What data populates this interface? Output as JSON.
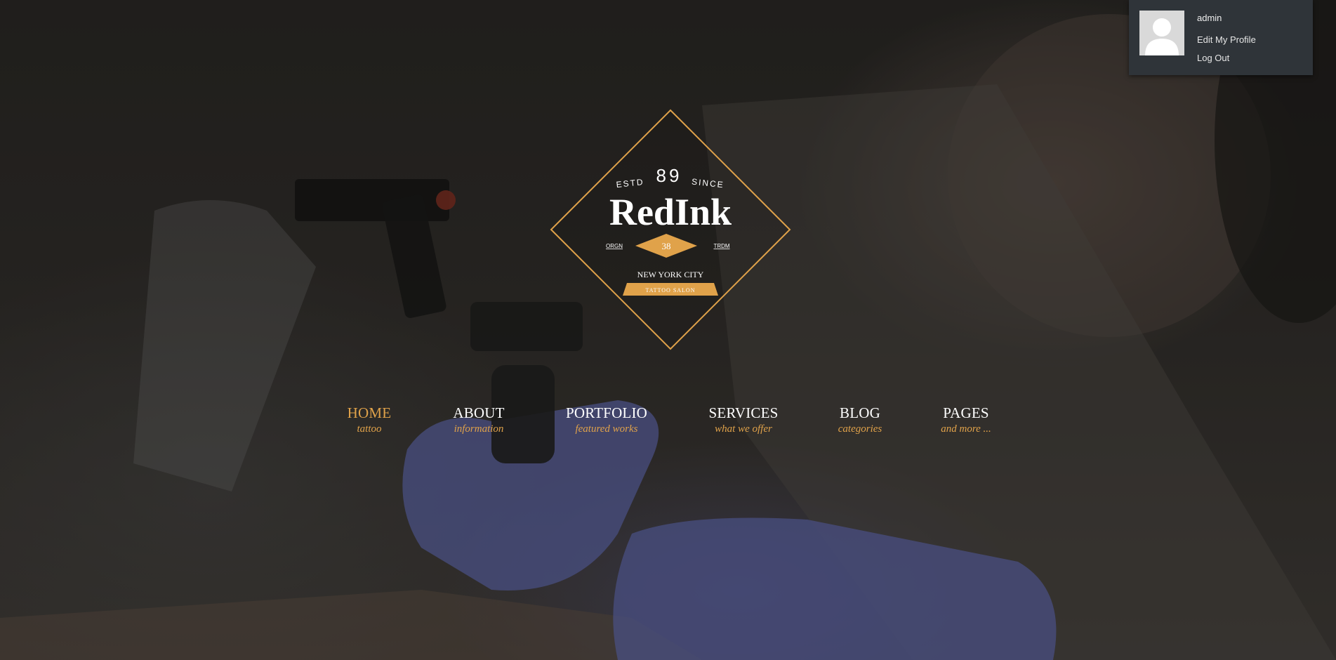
{
  "colors": {
    "accent": "#e0a24a",
    "nav_text": "#ffffff",
    "admin_bg": "#2f3439"
  },
  "admin_bar": {
    "username": "admin",
    "edit_profile": "Edit My Profile",
    "log_out": "Log Out",
    "avatar_icon": "user-silhouette-icon"
  },
  "logo": {
    "estd": "ESTD",
    "year_top": "89",
    "since": "SINCE",
    "brand": "RedInk",
    "left_tag": "ORGN",
    "right_tag": "TRDM",
    "badge_number": "38",
    "city": "NEW YORK CITY",
    "ribbon": "TATTOO SALON"
  },
  "nav": {
    "items": [
      {
        "label": "HOME",
        "sub": "tattoo",
        "active": true
      },
      {
        "label": "ABOUT",
        "sub": "information",
        "active": false
      },
      {
        "label": "PORTFOLIO",
        "sub": "featured works",
        "active": false
      },
      {
        "label": "SERVICES",
        "sub": "what we offer",
        "active": false
      },
      {
        "label": "BLOG",
        "sub": "categories",
        "active": false
      },
      {
        "label": "PAGES",
        "sub": "and more ...",
        "active": false
      }
    ]
  }
}
